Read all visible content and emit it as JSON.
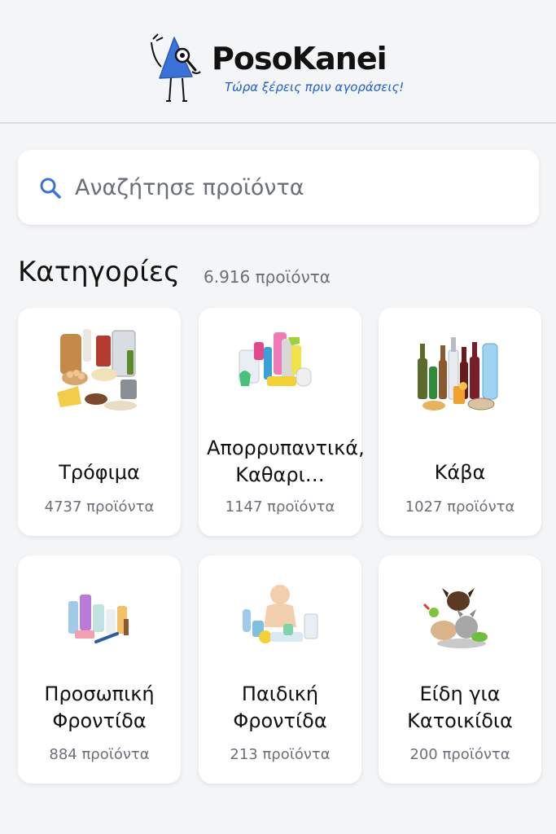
{
  "header": {
    "brand": "PosoKanei",
    "tagline": "Τώρα ξέρεις πριν αγοράσεις!",
    "mascot_icon": "mascot-magnifier-icon"
  },
  "search": {
    "placeholder": "Αναζήτησε προϊόντα",
    "icon": "search-icon"
  },
  "categories_section": {
    "title": "Κατηγορίες",
    "total": "6.916 προϊόντα"
  },
  "categories": [
    {
      "name": "Τρόφιμα",
      "count": "4737 προϊόντα",
      "icon": "groceries-image"
    },
    {
      "name": "Απορρυπαντικά, Καθαρι…",
      "count": "1147 προϊόντα",
      "icon": "cleaning-products-image"
    },
    {
      "name": "Κάβα",
      "count": "1027 προϊόντα",
      "icon": "drinks-image"
    },
    {
      "name": "Προσωπική Φροντίδα",
      "count": "884 προϊόντα",
      "icon": "personal-care-image"
    },
    {
      "name": "Παιδική Φροντίδα",
      "count": "213 προϊόντα",
      "icon": "baby-care-image"
    },
    {
      "name": "Είδη για Κατοικίδια",
      "count": "200 προϊόντα",
      "icon": "pets-image"
    }
  ],
  "colors": {
    "accent": "#1f5fd1",
    "mascot": "#3b72d9",
    "background": "#f4f5f7",
    "card": "#ffffff",
    "muted_text": "#6b6f78"
  }
}
